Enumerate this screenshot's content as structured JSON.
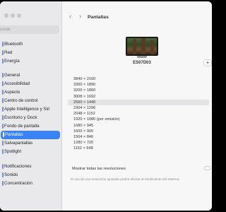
{
  "sidebar": {
    "search_placeholder": "uscar",
    "items": [
      {
        "label": "Bluetooth",
        "active": false
      },
      {
        "label": "Red",
        "active": false
      },
      {
        "label": "Energía",
        "active": false
      },
      {
        "label": "General",
        "active": false
      },
      {
        "label": "Accesibilidad",
        "active": false
      },
      {
        "label": "Aspecto",
        "active": false
      },
      {
        "label": "Centro de control",
        "active": false
      },
      {
        "label": "Apple Intelligence y Siri",
        "active": false
      },
      {
        "label": "Escritorio y Dock",
        "active": false
      },
      {
        "label": "Fondo de pantalla",
        "active": false
      },
      {
        "label": "Pantallas",
        "active": true
      },
      {
        "label": "Salvapantallas",
        "active": false
      },
      {
        "label": "Spotlight",
        "active": false
      },
      {
        "label": "Notificaciones",
        "active": false
      },
      {
        "label": "Sonido",
        "active": false
      },
      {
        "label": "Concentración",
        "active": false
      }
    ]
  },
  "toolbar": {
    "back_icon": "‹",
    "forward_icon": "›",
    "title": "Pantallas"
  },
  "display": {
    "name": "ES07D03",
    "add_label": "+"
  },
  "resolutions": {
    "options": [
      "3840 × 2160",
      "3360 × 1890",
      "3200 × 1800",
      "3008 × 1692",
      "2560 × 1440",
      "2304 × 1296",
      "2048 × 1152",
      "1920 × 1080 (por omisión)",
      "1680 × 945",
      "1600 × 900",
      "1504 × 846",
      "1280 × 720",
      "1152 × 648"
    ],
    "selected_index": 4
  },
  "show_all": {
    "label": "Mostrar todas las resoluciones",
    "checked": false
  },
  "note": "El uso de una resolución ajustada podría afectar al rendimiento del sistema."
}
